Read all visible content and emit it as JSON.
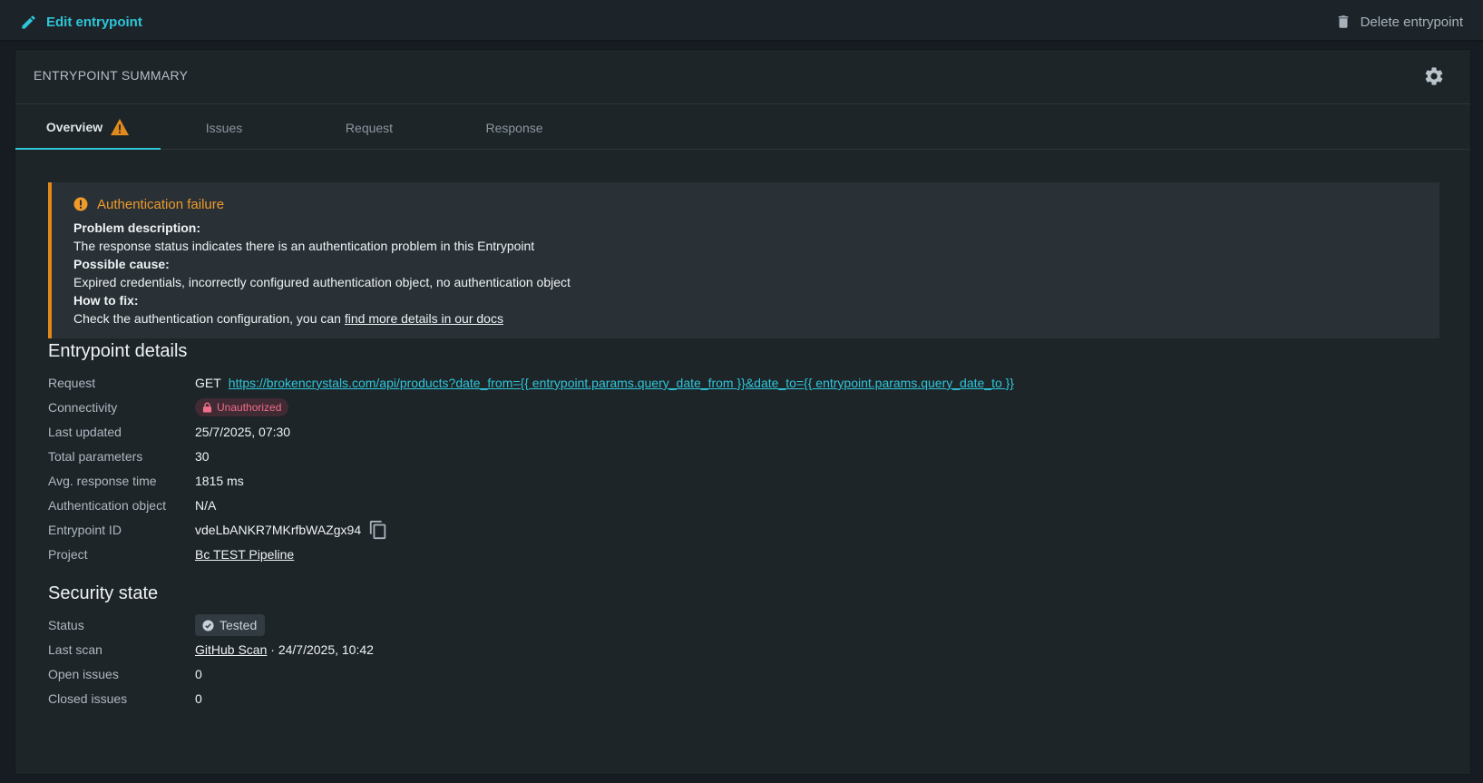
{
  "topbar": {
    "edit_label": "Edit entrypoint",
    "delete_label": "Delete entrypoint"
  },
  "panel": {
    "title": "ENTRYPOINT SUMMARY"
  },
  "tabs": [
    {
      "label": "Overview",
      "active": true,
      "warning": true
    },
    {
      "label": "Issues",
      "active": false
    },
    {
      "label": "Request",
      "active": false
    },
    {
      "label": "Response",
      "active": false
    }
  ],
  "alert": {
    "title": "Authentication failure",
    "problem_heading": "Problem description:",
    "problem_text": "The response status indicates there is an authentication problem in this Entrypoint",
    "cause_heading": "Possible cause:",
    "cause_text": "Expired credentials, incorrectly configured authentication object, no authentication object",
    "fix_heading": "How to fix:",
    "fix_text": "Check the authentication configuration, you can ",
    "fix_link": "find more details in our docs"
  },
  "details": {
    "title": "Entrypoint details",
    "request_label": "Request",
    "request_method": "GET",
    "request_url": "https://brokencrystals.com/api/products?date_from={{ entrypoint.params.query_date_from }}&date_to={{ entrypoint.params.query_date_to }}",
    "connectivity_label": "Connectivity",
    "connectivity_value": "Unauthorized",
    "updated_label": "Last updated",
    "updated_value": "25/7/2025, 07:30",
    "params_label": "Total parameters",
    "params_value": "30",
    "resp_label": "Avg. response time",
    "resp_value": "1815 ms",
    "auth_label": "Authentication object",
    "auth_value": "N/A",
    "id_label": "Entrypoint ID",
    "id_value": "vdeLbANKR7MKrfbWAZgx94",
    "project_label": "Project",
    "project_value": "Bc TEST Pipeline"
  },
  "security": {
    "title": "Security state",
    "status_label": "Status",
    "status_value": "Tested",
    "scan_label": "Last scan",
    "scan_link": "GitHub Scan",
    "scan_date": " · 24/7/2025, 10:42",
    "open_label": "Open issues",
    "open_value": "0",
    "closed_label": "Closed issues",
    "closed_value": "0"
  },
  "colors": {
    "accent": "#2ec5d8",
    "warning": "#e08a1e",
    "error": "#ef6f8a"
  }
}
